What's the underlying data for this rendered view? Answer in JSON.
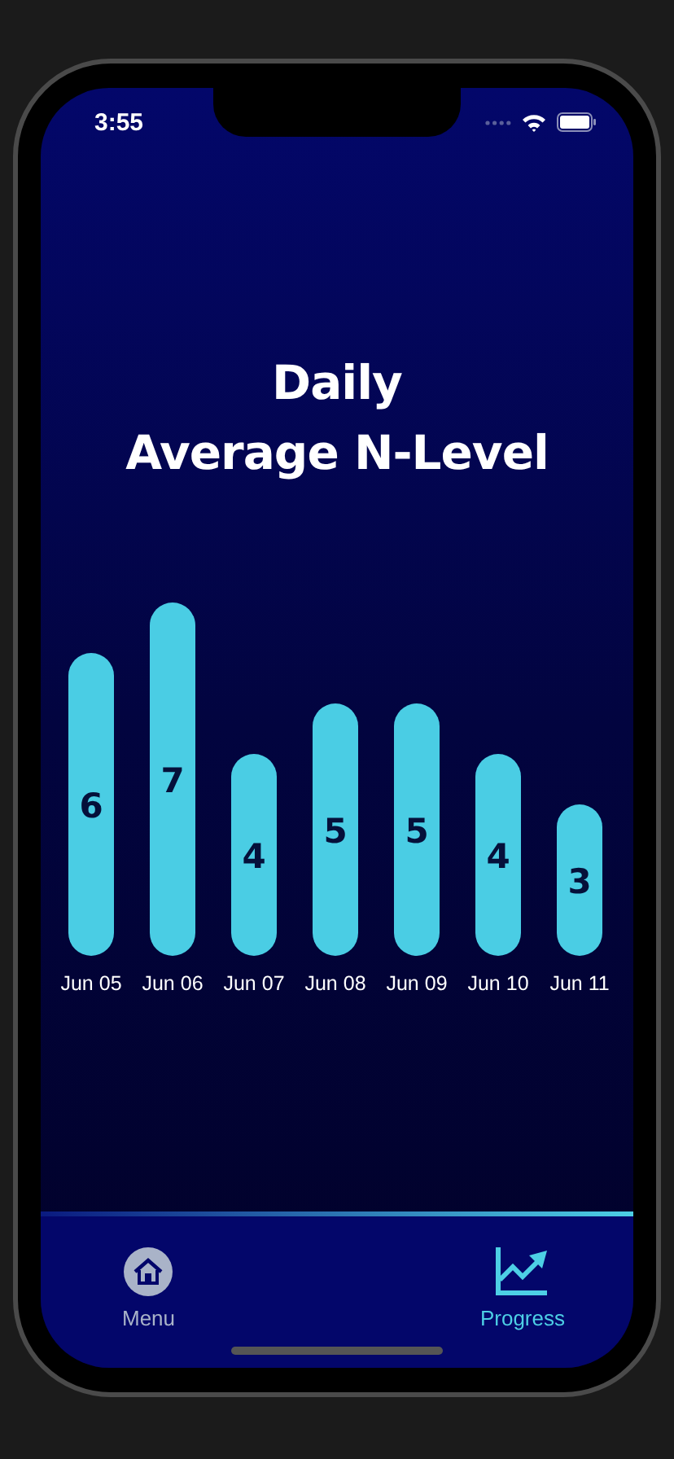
{
  "status_bar": {
    "time": "3:55"
  },
  "title": {
    "lines": [
      "Daily",
      "Average N-Level"
    ]
  },
  "chart_data": {
    "type": "bar",
    "categories": [
      "Jun 05",
      "Jun 06",
      "Jun 07",
      "Jun 08",
      "Jun 09",
      "Jun 10",
      "Jun 11"
    ],
    "values": [
      6,
      7,
      4,
      5,
      5,
      4,
      3
    ],
    "data_labels": true
  },
  "tabs": [
    {
      "label": "Menu",
      "kind": "home",
      "selected": false
    },
    {
      "label": "Progress",
      "kind": "chart",
      "selected": true
    }
  ]
}
